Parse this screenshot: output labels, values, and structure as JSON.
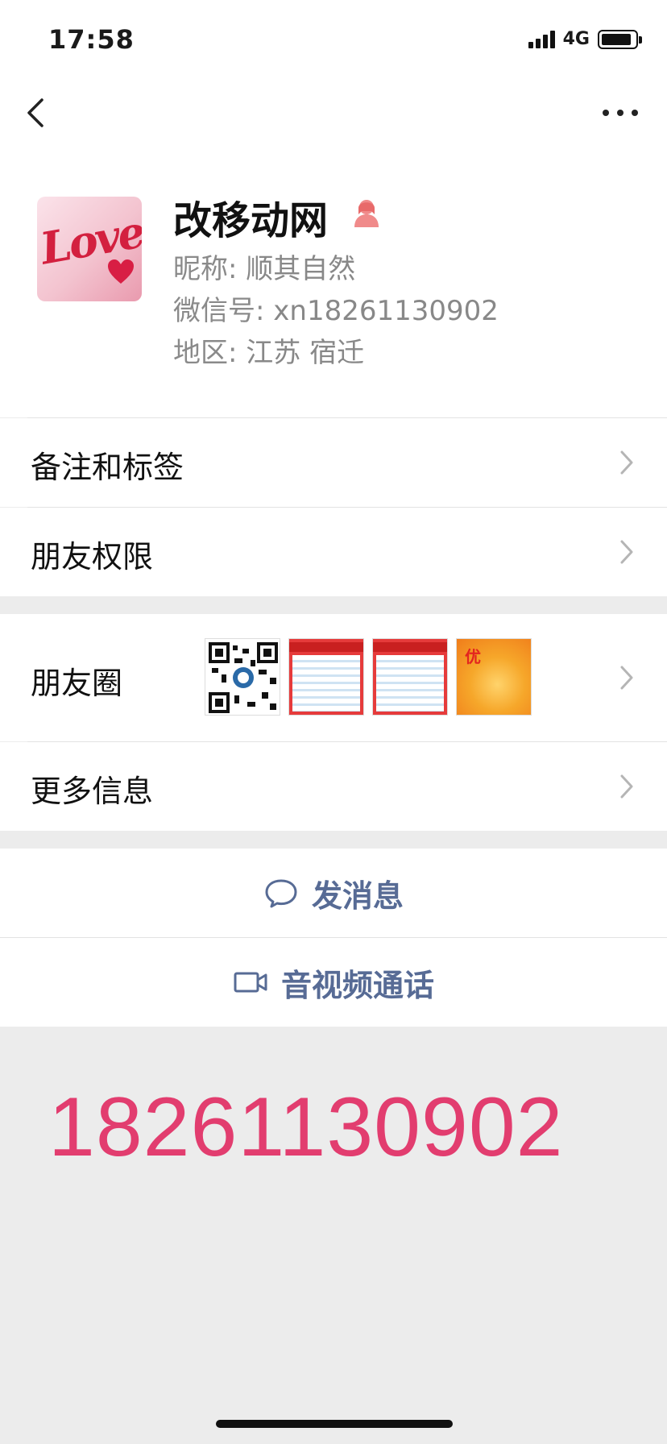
{
  "status_bar": {
    "time": "17:58",
    "network": "4G",
    "battery_level": 0.9
  },
  "nav": {
    "back_icon": "chevron-left-icon",
    "more_icon": "ellipsis-icon"
  },
  "profile": {
    "display_name": "改移动网",
    "gender_icon": "female-icon",
    "nickname_label": "昵称:",
    "nickname": "顺其自然",
    "wechat_id_label": "微信号:",
    "wechat_id": "xn18261130902",
    "region_label": "地区:",
    "region": "江苏 宿迁",
    "avatar_text": "Love"
  },
  "rows": {
    "remarks": "备注和标签",
    "permissions": "朋友权限",
    "moments": "朋友圈",
    "more_info": "更多信息"
  },
  "moments_thumbs": [
    "qr-code-image",
    "number-list-image",
    "number-list-image",
    "promo-image"
  ],
  "moments_promo_text": "优",
  "actions": {
    "message": "发消息",
    "call": "音视频通话"
  },
  "overlay": {
    "phone_number": "18261130902"
  },
  "colors": {
    "link_blue": "#576b95",
    "overlay_pink": "#e23d6f",
    "page_bg": "#ececec"
  }
}
